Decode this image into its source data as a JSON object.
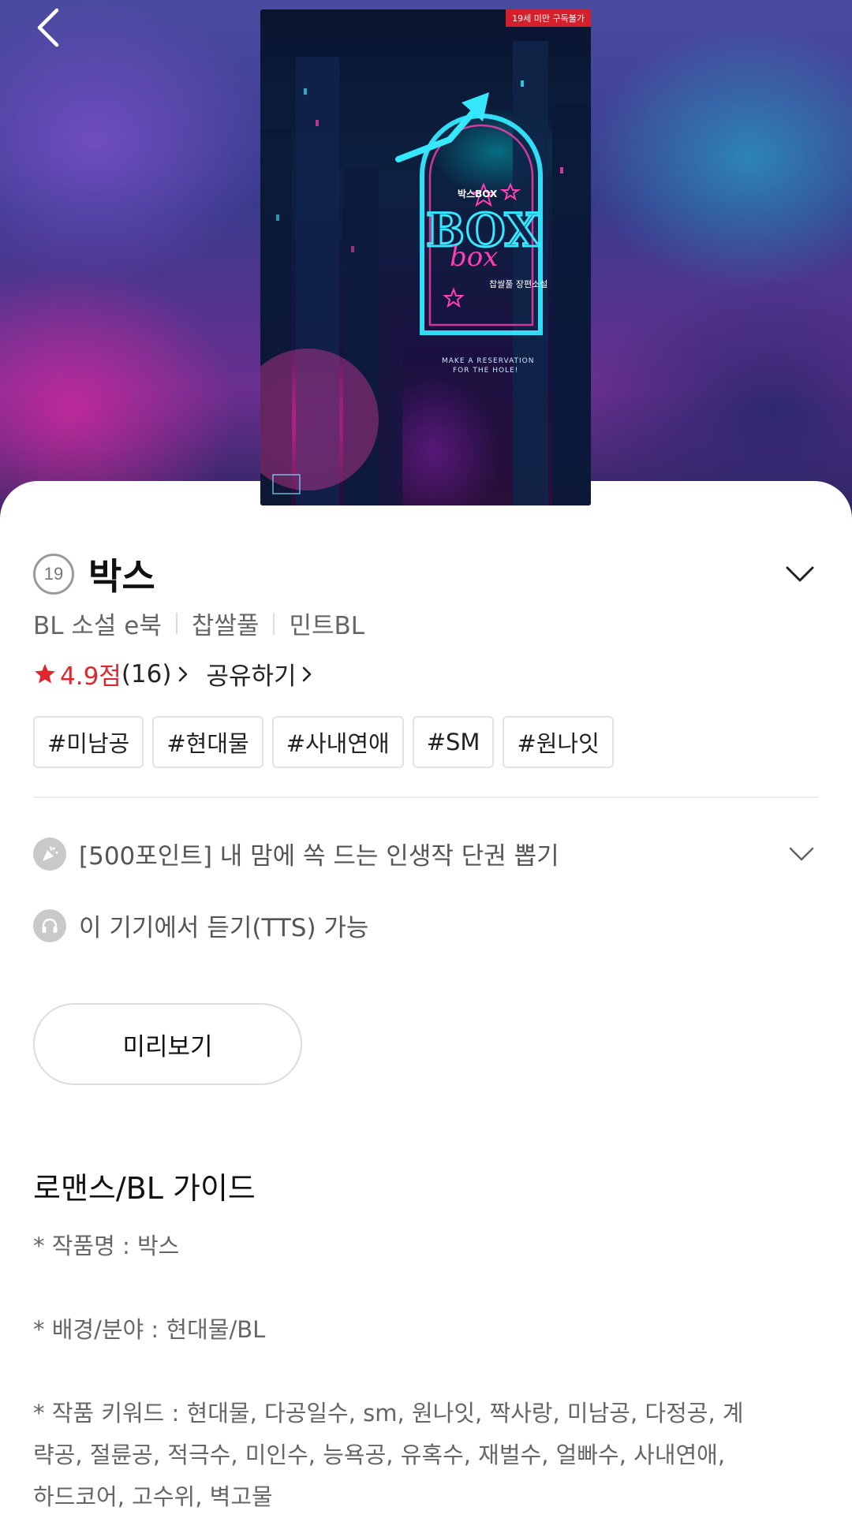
{
  "hero": {
    "age_restriction_label": "19세 미만 구독불가",
    "cover_text": {
      "publisher_mark": "박스BOX",
      "logo_main": "BOX",
      "logo_script": "box",
      "author_line": "찹쌀풀 장편소설",
      "tagline_1": "MAKE A RESERVATION",
      "tagline_2": "FOR THE HOLE!"
    }
  },
  "book": {
    "age_badge": "19",
    "title": "박스",
    "meta": [
      "BL 소설 e북",
      "찹쌀풀",
      "민트BL"
    ],
    "rating": "4.9점",
    "rating_count": "(16)",
    "share_label": "공유하기",
    "tags": [
      "#미남공",
      "#현대물",
      "#사내연애",
      "#SM",
      "#원나잇"
    ]
  },
  "promos": {
    "event_text": "[500포인트] 내 맘에 쏙 드는 인생작 단권 뽑기",
    "tts_text": "이 기기에서 듣기(TTS) 가능"
  },
  "preview_label": "미리보기",
  "guide": {
    "title": "로맨스/BL 가이드",
    "line1": "* 작품명 : 박스",
    "line2": "* 배경/분야 : 현대물/BL",
    "line3a": "* 작품 키워드 : 현대물, 다공일수, sm, 원나잇, 짝사랑, 미남공, 다정공, 계",
    "line3b": "략공, 절륜공, 적극수, 미인수, 능욕공, 유혹수, 재벌수, 얼빠수, 사내연애,",
    "line3c": "하드코어, 고수위, 벽고물"
  },
  "colors": {
    "accent_red": "#e0262f",
    "neon_cyan": "#35e8ff",
    "neon_pink": "#ff3fb0"
  }
}
